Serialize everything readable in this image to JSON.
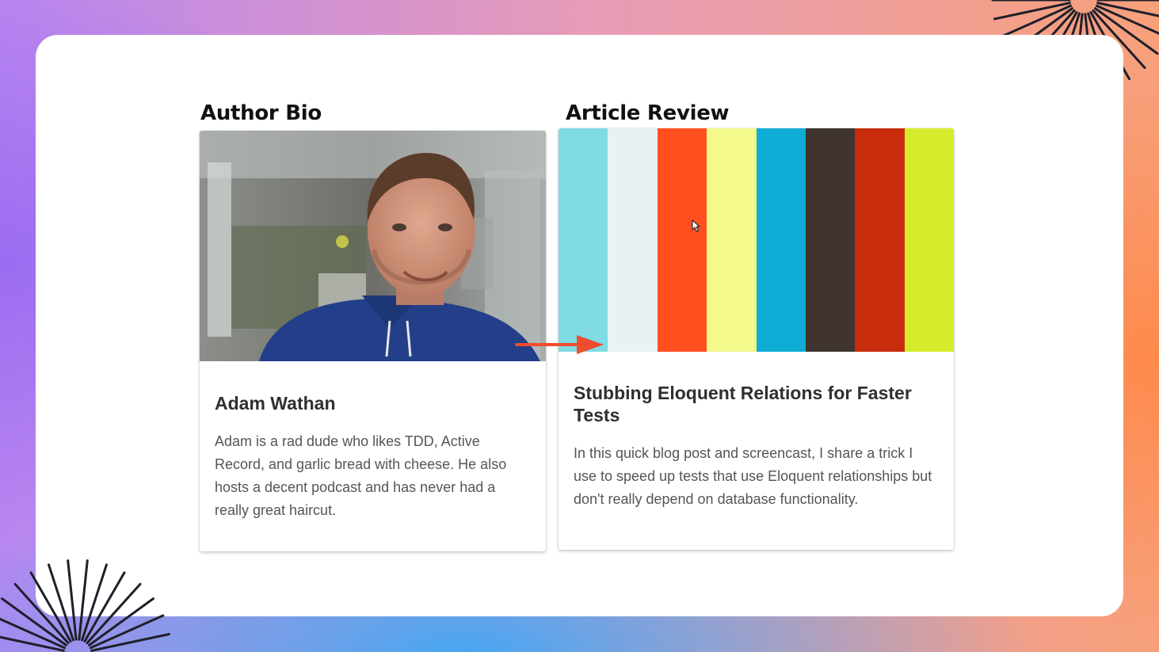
{
  "author_section": {
    "heading": "Author Bio",
    "name": "Adam Wathan",
    "bio": "Adam is a rad dude who likes TDD, Active Record, and garlic bread with cheese. He also hosts a decent podcast and has never had a really great haircut."
  },
  "article_section": {
    "heading": "Article Review",
    "title": "Stubbing Eloquent Relations for Faster Tests",
    "summary": "In this quick blog post and screencast, I share a trick I use to speed up tests that use Eloquent relationships but don't really depend on database functionality.",
    "stripe_colors": [
      "#7fdbe4",
      "#e8f1f3",
      "#ff4f1f",
      "#f3f98a",
      "#0fadd6",
      "#3f342f",
      "#c72d0c",
      "#d4ec2b"
    ]
  },
  "colors": {
    "annotation_arrow": "#ee4d2e",
    "burst": "#1f1f2a"
  },
  "icons": {
    "cursor": "mouse-pointer-icon",
    "arrow": "annotation-arrow-icon",
    "burst": "sunburst-decoration-icon"
  }
}
